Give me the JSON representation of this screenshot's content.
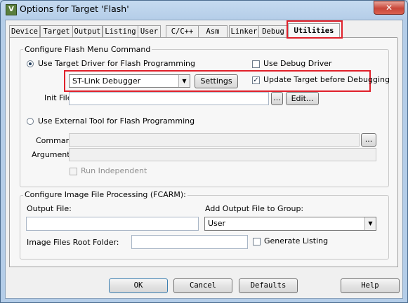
{
  "window": {
    "title": "Options for Target 'Flash'",
    "close_glyph": "✕",
    "app_icon_glyph": "V"
  },
  "tabs": [
    {
      "label": "Device"
    },
    {
      "label": "Target"
    },
    {
      "label": "Output"
    },
    {
      "label": "Listing"
    },
    {
      "label": "User"
    },
    {
      "label": "C/C++"
    },
    {
      "label": "Asm"
    },
    {
      "label": "Linker"
    },
    {
      "label": "Debug"
    },
    {
      "label": "Utilities"
    }
  ],
  "active_tab": "Utilities",
  "flash_group": {
    "title": "Configure Flash Menu Command",
    "use_target_driver_label": "Use Target Driver for Flash Programming",
    "use_target_driver_selected": true,
    "use_debug_driver_label": "Use Debug Driver",
    "use_debug_driver_checked": false,
    "driver_value": "ST-Link Debugger",
    "settings_label": "Settings",
    "update_target_label": "Update Target before Debugging",
    "update_target_checked": true,
    "init_file_label": "Init File:",
    "init_file_value": "",
    "browse_label": "...",
    "edit_label": "Edit...",
    "use_external_tool_label": "Use External Tool for Flash Programming",
    "use_external_tool_selected": false,
    "command_label": "Command:",
    "command_value": "",
    "command_browse_label": "...",
    "arguments_label": "Arguments:",
    "arguments_value": "",
    "run_independent_label": "Run Independent",
    "run_independent_checked": false
  },
  "image_group": {
    "title": "Configure Image File Processing (FCARM):",
    "output_file_label": "Output File:",
    "output_file_value": "",
    "add_output_label": "Add Output File  to Group:",
    "group_value": "User",
    "root_folder_label": "Image Files Root Folder:",
    "root_folder_value": "",
    "generate_listing_label": "Generate Listing",
    "generate_listing_checked": false
  },
  "buttons": {
    "ok": "OK",
    "cancel": "Cancel",
    "defaults": "Defaults",
    "help": "Help"
  },
  "colors": {
    "highlight": "#e0202a",
    "title_bar": "#b9d1ea"
  }
}
